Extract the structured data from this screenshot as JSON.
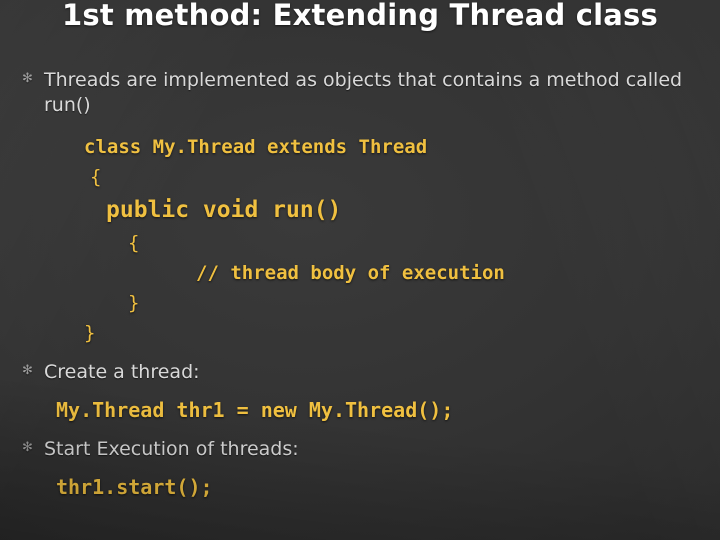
{
  "slide": {
    "title": "1st method: Extending Thread class",
    "bullet_marker": "✻",
    "bullets": [
      "Threads are implemented as objects that contains a method called run()",
      "Create a thread:",
      "Start Execution of threads:"
    ],
    "code_block": {
      "line_class": "class My.Thread extends Thread",
      "line_open_brace_1": "{",
      "line_public": "public void run()",
      "line_open_brace_2": "{",
      "line_comment": "// thread body of execution",
      "line_close_brace_2": "}",
      "line_close_brace_1": "}"
    },
    "create_thread_code": "My.Thread thr1 = new My.Thread();",
    "start_thread_code": "thr1.start();",
    "colors": {
      "background": "#333333",
      "title": "#ffffff",
      "bullet_text": "#d9d9d9",
      "code": "#f0c040",
      "marker": "#9a9a9a"
    }
  }
}
